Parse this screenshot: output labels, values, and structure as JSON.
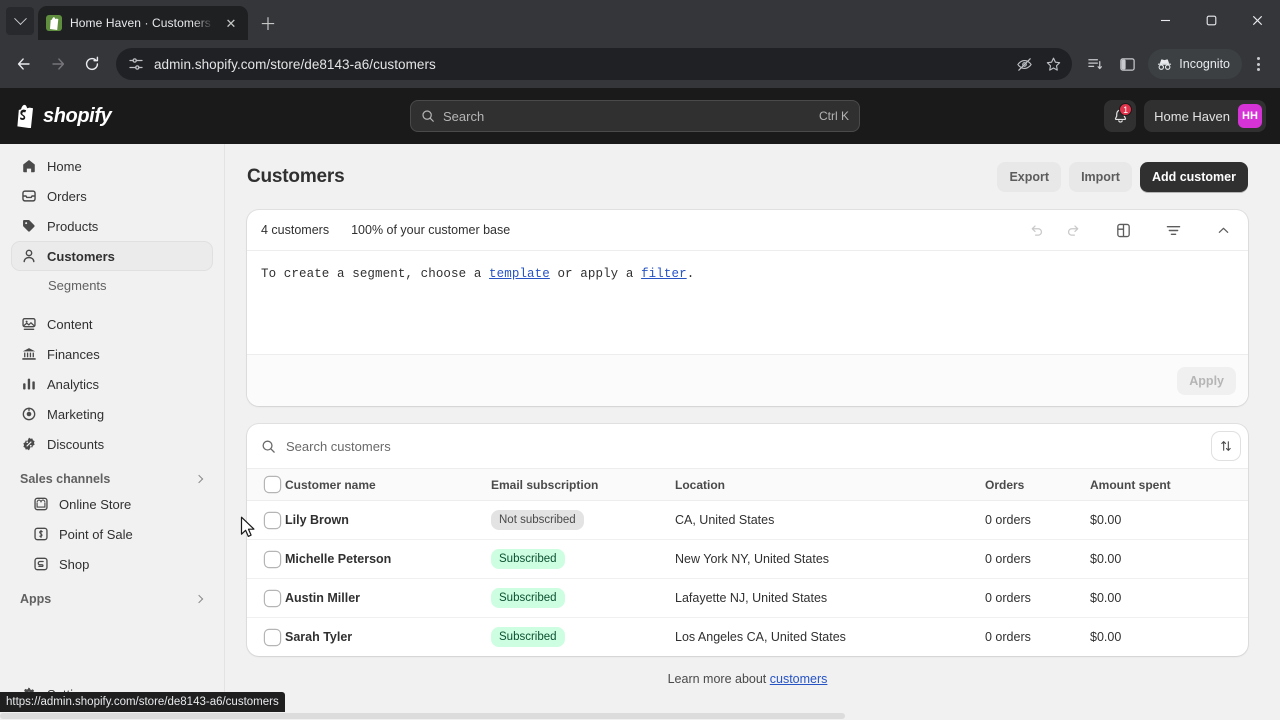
{
  "browser": {
    "tab": {
      "title": "Home Haven · Customers · Sho",
      "favicon_icon": "shopify-favicon",
      "close_icon": "close-icon",
      "newtab_icon": "plus-icon",
      "dropdown_icon": "chevron-down-icon"
    },
    "window_controls": {
      "minimize_icon": "minimize-icon",
      "maximize_icon": "maximize-icon",
      "close_icon": "close-icon"
    },
    "nav": {
      "back_icon": "back-arrow-icon",
      "forward_icon": "forward-arrow-icon",
      "reload_icon": "reload-icon"
    },
    "omnibox": {
      "site_settings_icon": "tune-icon",
      "url": "admin.shopify.com/store/de8143-a6/customers",
      "tracking_protection_icon": "eye-slash-icon",
      "bookmark_icon": "star-icon"
    },
    "toolbar": {
      "reading_list_icon": "reading-list-icon",
      "side_panel_icon": "side-panel-icon",
      "incognito_label": "Incognito",
      "incognito_icon": "incognito-hat-icon",
      "menu_icon": "kebab-menu-icon"
    },
    "status_bar_url": "https://admin.shopify.com/store/de8143-a6/customers"
  },
  "topbar": {
    "brand": "shopify",
    "brand_icon": "shopify-bag-icon",
    "search": {
      "placeholder": "Search",
      "shortcut": "Ctrl K",
      "icon": "search-icon"
    },
    "notifications": {
      "icon": "bell-icon",
      "count": "1"
    },
    "store_name": "Home Haven",
    "avatar_initials": "HH",
    "avatar_color": "#d633d6"
  },
  "sidebar": {
    "items": [
      {
        "label": "Home",
        "icon": "home-icon",
        "active": false
      },
      {
        "label": "Orders",
        "icon": "orders-inbox-icon",
        "active": false
      },
      {
        "label": "Products",
        "icon": "product-tag-icon",
        "active": false
      },
      {
        "label": "Customers",
        "icon": "person-icon",
        "active": true
      },
      {
        "label": "Content",
        "icon": "content-image-icon",
        "active": false
      },
      {
        "label": "Finances",
        "icon": "bank-icon",
        "active": false
      },
      {
        "label": "Analytics",
        "icon": "bar-chart-icon",
        "active": false
      },
      {
        "label": "Marketing",
        "icon": "marketing-target-icon",
        "active": false
      },
      {
        "label": "Discounts",
        "icon": "discount-badge-icon",
        "active": false
      }
    ],
    "sub_item": {
      "label": "Segments"
    },
    "sales_channels": {
      "label": "Sales channels",
      "chevron_icon": "chevron-right-icon",
      "items": [
        {
          "label": "Online Store",
          "icon": "storefront-icon"
        },
        {
          "label": "Point of Sale",
          "icon": "pos-icon"
        },
        {
          "label": "Shop",
          "icon": "shop-icon"
        }
      ]
    },
    "apps": {
      "label": "Apps",
      "chevron_icon": "chevron-right-icon"
    },
    "settings": {
      "label": "Settings",
      "icon": "gear-icon"
    }
  },
  "main": {
    "page_title": "Customers",
    "actions": {
      "export": "Export",
      "import": "Import",
      "add_customer": "Add customer"
    },
    "segment_card": {
      "count": "4 customers",
      "percent": "100% of your customer base",
      "tools": [
        {
          "icon": "undo-icon",
          "disabled": true
        },
        {
          "icon": "redo-icon",
          "disabled": true
        },
        {
          "icon": "columns-layout-icon",
          "disabled": false
        },
        {
          "icon": "filter-icon",
          "disabled": false
        },
        {
          "icon": "chevron-up-icon",
          "disabled": false
        }
      ],
      "editor": {
        "prefix": "To create a segment, choose a ",
        "link_template": "template",
        "middle": " or apply a ",
        "link_filter": "filter",
        "suffix": "."
      },
      "apply_label": "Apply"
    },
    "table_card": {
      "search_placeholder": "Search customers",
      "search_icon": "search-icon",
      "sort_icon": "sort-arrows-icon",
      "select_all_checkbox": "select-all-checkbox",
      "columns": [
        "Customer name",
        "Email subscription",
        "Location",
        "Orders",
        "Amount spent"
      ],
      "rows": [
        {
          "name": "Lily Brown",
          "subscription": "Not subscribed",
          "subscribed": false,
          "location": "CA, United States",
          "orders": "0 orders",
          "amount": "$0.00"
        },
        {
          "name": "Michelle Peterson",
          "subscription": "Subscribed",
          "subscribed": true,
          "location": "New York NY, United States",
          "orders": "0 orders",
          "amount": "$0.00"
        },
        {
          "name": "Austin Miller",
          "subscription": "Subscribed",
          "subscribed": true,
          "location": "Lafayette NJ, United States",
          "orders": "0 orders",
          "amount": "$0.00"
        },
        {
          "name": "Sarah Tyler",
          "subscription": "Subscribed",
          "subscribed": true,
          "location": "Los Angeles CA, United States",
          "orders": "0 orders",
          "amount": "$0.00"
        }
      ]
    },
    "footer": {
      "text": "Learn more about ",
      "link": "customers"
    }
  },
  "colors": {
    "subscribed_bg": "#cdfee1",
    "subscribed_text": "#0c5132",
    "not_subscribed_bg": "#e3e3e3",
    "link": "#2754c5",
    "primary_button": "#303030"
  }
}
